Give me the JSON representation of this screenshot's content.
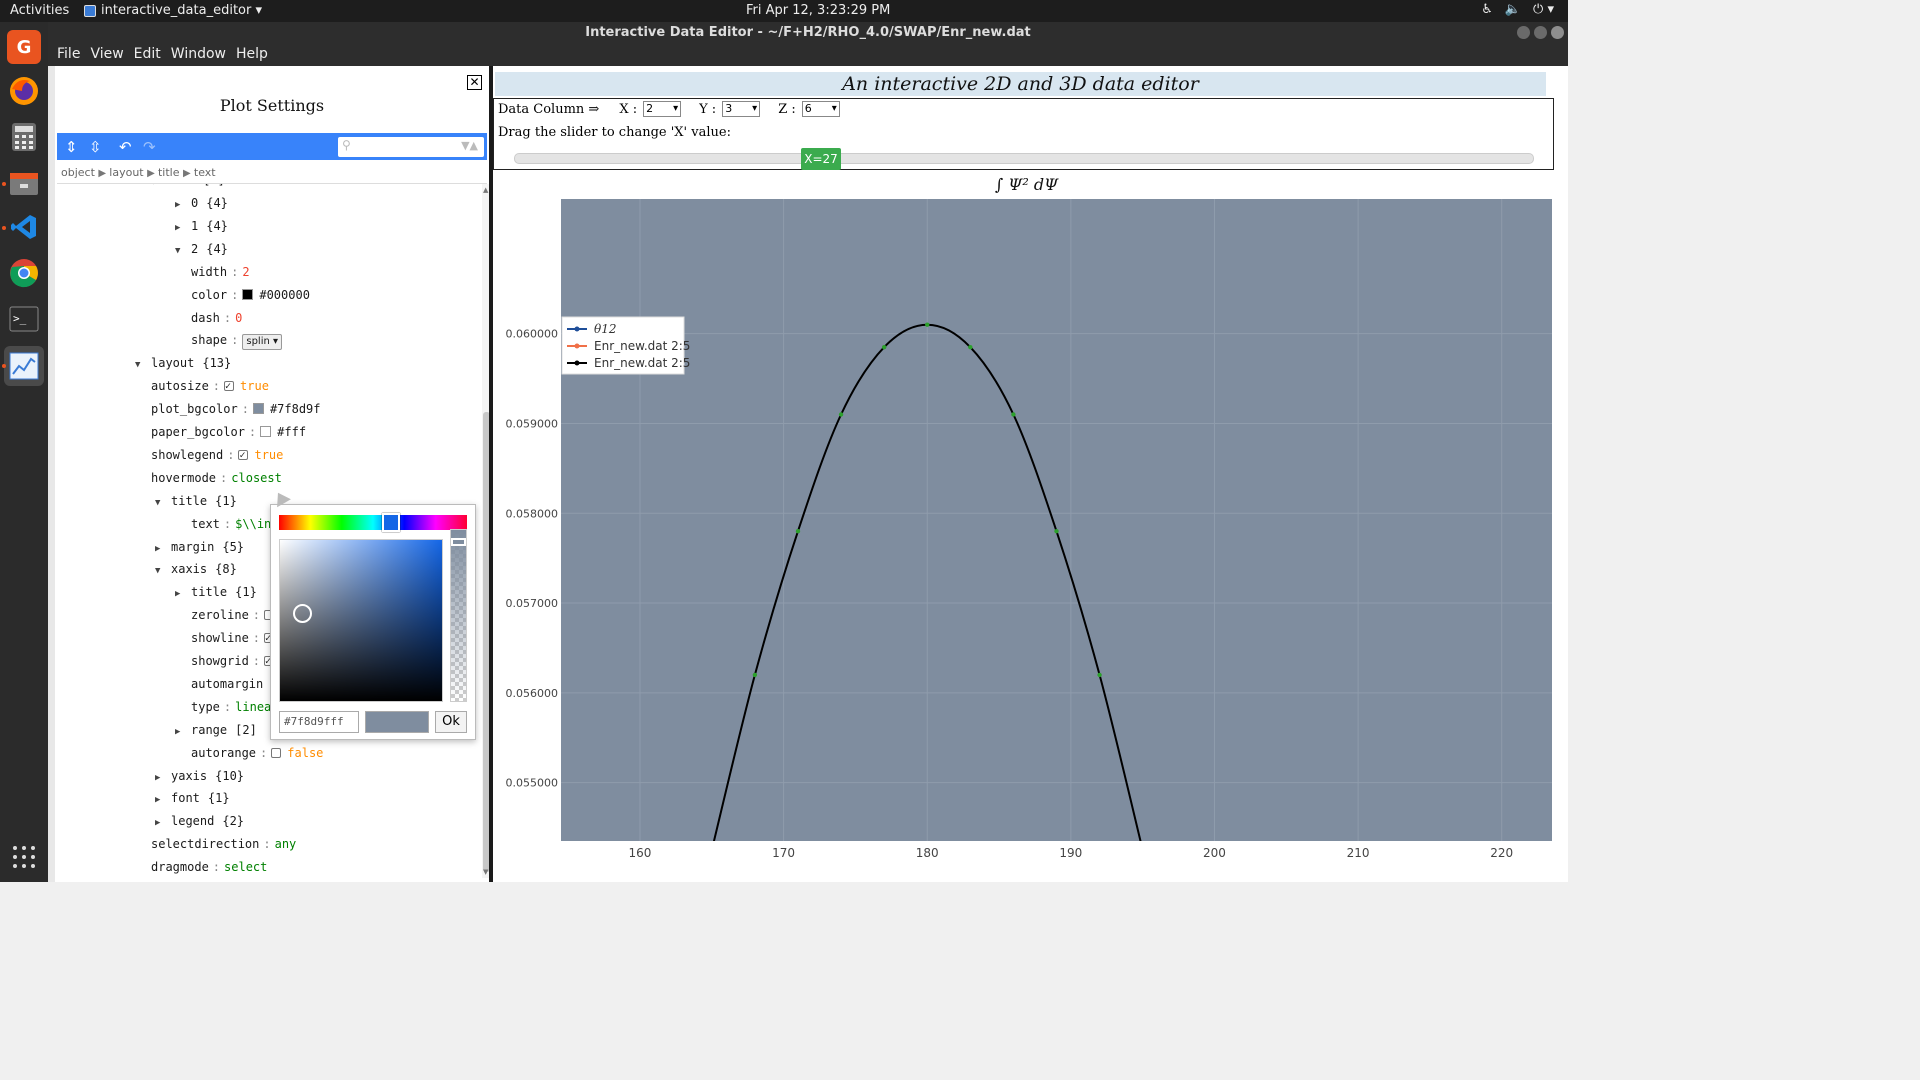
{
  "topbar": {
    "activities": "Activities",
    "app_name": "interactive_data_editor ▾",
    "clock": "Fri Apr 12,  3:23:29 PM"
  },
  "window": {
    "title": "Interactive Data Editor - ~/F+H2/RHO_4.0/SWAP/Enr_new.dat"
  },
  "menu": [
    "File",
    "View",
    "Edit",
    "Window",
    "Help"
  ],
  "dock": [
    "pdf-app-icon",
    "firefox-icon",
    "calculator-icon",
    "file-manager-icon",
    "vscode-icon",
    "chrome-icon",
    "terminal-icon",
    "data-editor-icon",
    "app-grid-icon"
  ],
  "settings": {
    "title": "Plot Settings",
    "breadcrumb": [
      "object",
      "layout",
      "title",
      "text"
    ]
  },
  "tree": [
    {
      "indent": 120,
      "toggle": "▶",
      "key": "0",
      "value": "{4}"
    },
    {
      "indent": 120,
      "toggle": "▶",
      "key": "1",
      "value": "{4}"
    },
    {
      "indent": 120,
      "toggle": "▼",
      "key": "2",
      "value": "{4}"
    },
    {
      "indent": 136,
      "key": "width",
      "value": "2",
      "vtype": "num"
    },
    {
      "indent": 136,
      "key": "color",
      "value": "#000000",
      "vtype": "plain",
      "swatch": "#000000"
    },
    {
      "indent": 136,
      "key": "dash",
      "value": "0",
      "vtype": "num"
    },
    {
      "indent": 136,
      "key": "shape",
      "value": "splin",
      "vtype": "select"
    },
    {
      "indent": 80,
      "toggle": "▼",
      "key": "layout",
      "value": "{13}"
    },
    {
      "indent": 96,
      "key": "autosize",
      "value": "true",
      "vtype": "bool",
      "checkbox": true
    },
    {
      "indent": 96,
      "key": "plot_bgcolor",
      "value": "#7f8d9f",
      "vtype": "plain",
      "swatch": "#7f8d9f"
    },
    {
      "indent": 96,
      "key": "paper_bgcolor",
      "value": "#fff",
      "vtype": "plain",
      "swatch": "#ffffff"
    },
    {
      "indent": 96,
      "key": "showlegend",
      "value": "true",
      "vtype": "bool",
      "checkbox": true
    },
    {
      "indent": 96,
      "key": "hovermode",
      "value": "closest",
      "vtype": "str"
    },
    {
      "indent": 100,
      "toggle": "▼",
      "key": "title",
      "value": "{1}"
    },
    {
      "indent": 136,
      "key": "text",
      "value": "$\\\\int",
      "vtype": "str"
    },
    {
      "indent": 100,
      "toggle": "▶",
      "key": "margin",
      "value": "{5}"
    },
    {
      "indent": 100,
      "toggle": "▼",
      "key": "xaxis",
      "value": "{8}"
    },
    {
      "indent": 120,
      "toggle": "▶",
      "key": "title",
      "value": "{1}"
    },
    {
      "indent": 136,
      "key": "zeroline",
      "value": "false",
      "vtype": "bool",
      "checkbox": false
    },
    {
      "indent": 136,
      "key": "showline",
      "value": "true",
      "vtype": "bool",
      "checkbox": true
    },
    {
      "indent": 136,
      "key": "showgrid",
      "value": "true",
      "vtype": "bool",
      "checkbox": true
    },
    {
      "indent": 136,
      "key": "automargin",
      "value": "true",
      "vtype": "bool",
      "checkbox": true
    },
    {
      "indent": 136,
      "key": "type",
      "value": "linear",
      "vtype": "str"
    },
    {
      "indent": 120,
      "toggle": "▶",
      "key": "range",
      "value": "[2]"
    },
    {
      "indent": 136,
      "key": "autorange",
      "value": "false",
      "vtype": "bool",
      "checkbox": false
    },
    {
      "indent": 100,
      "toggle": "▶",
      "key": "yaxis",
      "value": "{10}"
    },
    {
      "indent": 100,
      "toggle": "▶",
      "key": "font",
      "value": "{1}"
    },
    {
      "indent": 100,
      "toggle": "▶",
      "key": "legend",
      "value": "{2}"
    },
    {
      "indent": 96,
      "key": "selectdirection",
      "value": "any",
      "vtype": "str"
    },
    {
      "indent": 96,
      "key": "dragmode",
      "value": "select",
      "vtype": "str"
    }
  ],
  "picker": {
    "hex": "#7f8d9fff",
    "ok_label": "Ok",
    "color": "#7f8d9f"
  },
  "editor": {
    "header": "An interactive 2D and 3D data editor",
    "data_column_label": "Data Column ⇒",
    "x_label": "X :",
    "x_value": "2",
    "y_label": "Y :",
    "y_value": "3",
    "z_label": "Z :",
    "z_value": "6",
    "slider_hint": "Drag the slider to change 'X' value:",
    "slider_value": "X=27",
    "slider_fraction": 0.3
  },
  "colors": {
    "plot_bg": "#7f8d9f",
    "accent_blue": "#3883fa",
    "slider_green": "#3bab4e"
  },
  "chart_data": {
    "type": "line",
    "title": "∫ Ψ² dΨ",
    "xlim": [
      154.5,
      223.5
    ],
    "ylim": [
      0.05435,
      0.0615
    ],
    "xticks": [
      160,
      170,
      180,
      190,
      200,
      210,
      220
    ],
    "yticks": [
      "0.055000",
      "0.056000",
      "0.057000",
      "0.058000",
      "0.059000",
      "0.060000"
    ],
    "ytick_values": [
      0.055,
      0.056,
      0.057,
      0.058,
      0.059,
      0.06
    ],
    "grid": true,
    "legend_placement": "top-left",
    "series": [
      {
        "name": "θ12",
        "color": "#1f4e99",
        "x": [],
        "y": []
      },
      {
        "name": "Enr_new.dat 2:5",
        "color": "#f07048",
        "x": [],
        "y": []
      },
      {
        "name": "Enr_new.dat 2:5",
        "color": "#000000",
        "x": [
          165,
          168,
          171,
          174,
          177,
          180,
          183,
          186,
          189,
          192,
          195
        ],
        "y": [
          0.05425,
          0.0562,
          0.0578,
          0.0591,
          0.05985,
          0.0601,
          0.05985,
          0.0591,
          0.0578,
          0.0562,
          0.05425
        ]
      }
    ],
    "markers_x": [
      168,
      171,
      174,
      177,
      180,
      183,
      186,
      189,
      192
    ],
    "marker_color": "#2ca02c"
  }
}
